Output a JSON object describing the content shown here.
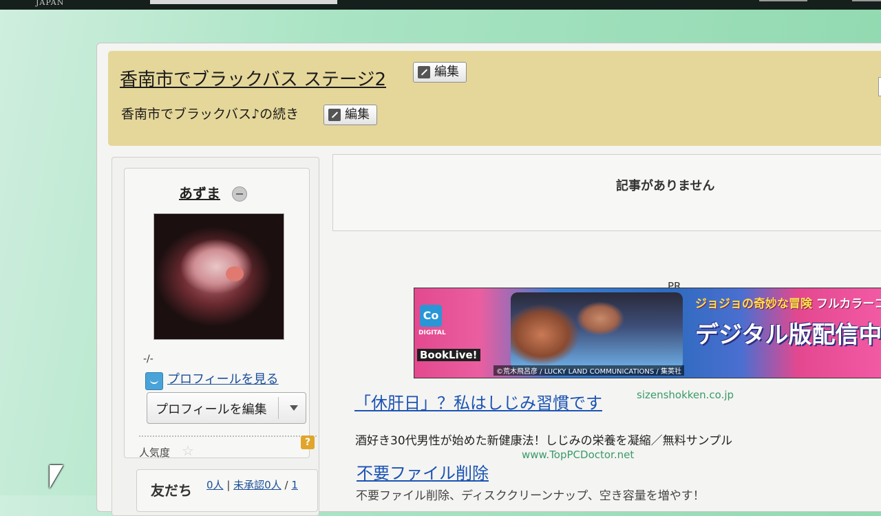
{
  "topbar": {
    "brand": "JAPAN"
  },
  "header": {
    "title": "香南市でブラックバス ステージ2",
    "subtitle": "香南市でブラックバス♪の続き",
    "edit_label": "編集"
  },
  "sidebar": {
    "username": "あずま",
    "dash": "-/-",
    "profile_link": "プロフィールを見る",
    "profile_edit": "プロフィールを編集",
    "popularity_label": "人気度",
    "help_icon_text": "?",
    "friends": {
      "title": "友だち",
      "count": "0人",
      "separator": "|",
      "pending": "未承認0人",
      "slash": "/",
      "page": "1"
    }
  },
  "main": {
    "no_articles": "記事がありません",
    "pr_label": "PR"
  },
  "banner": {
    "logo": "Co",
    "digital": "DIGITAL",
    "booklive": "BookLive!",
    "credit": "©荒木飛呂彦 / LUCKY LAND COMMUNICATIONS / 集英社",
    "head_yellow": "ジョジョの奇妙な冒険",
    "head_white": "フルカラーコミ",
    "main": "デジタル版配信中"
  },
  "ads": [
    {
      "title": "「休肝日」？私はしじみ習慣です",
      "domain": "sizenshokken.co.jp",
      "desc": "酒好き30代男性が始めた新健康法！しじみの栄養を凝縮／無料サンプル"
    },
    {
      "title": "不要ファイル削除",
      "domain": "www.TopPCDoctor.net",
      "desc": "不要ファイル削除、ディスククリーンナップ、空き容量を増やす！"
    }
  ]
}
